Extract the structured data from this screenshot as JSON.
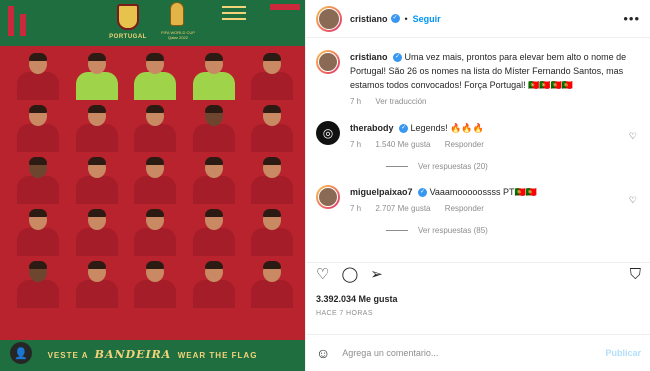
{
  "image": {
    "crest_label": "PORTUGAL",
    "wc_label": "FIFA WORLD CUP Qatar 2022",
    "footer": {
      "left": "VESTE A",
      "middle": "BANDEIRA",
      "right": "WEAR THE FLAG"
    },
    "colors": {
      "red": "#b8232e",
      "green": "#1f6e3f",
      "gold": "#f3d37a"
    }
  },
  "header": {
    "username": "cristiano",
    "verified": "✓",
    "separator": "•",
    "follow_label": "Seguir",
    "more_label": "•••"
  },
  "caption": {
    "username": "cristiano",
    "text": "Uma vez mais, prontos para elevar bem alto o nome de Portugal! São 26 os nomes na lista do Míster Fernando Santos, mas estamos todos convocados! Força Portugal! 🇵🇹🇵🇹🇵🇹🇵🇹",
    "time": "7 h",
    "translation": "Ver traducción"
  },
  "comments": [
    {
      "username": "therabody",
      "text": "Legends! 🔥🔥🔥",
      "time": "7 h",
      "likes": "1.540 Me gusta",
      "reply": "Responder",
      "replies": "Ver respuestas (20)"
    },
    {
      "username": "miguelpaixao7",
      "text": "Vaaamooooossss PT🇵🇹🇵🇹",
      "time": "7 h",
      "likes": "2.707 Me gusta",
      "reply": "Responder",
      "replies": "Ver respuestas (85)"
    }
  ],
  "likes_count": "3.392.034 Me gusta",
  "posted": "HACE 7 HORAS",
  "add_comment": {
    "placeholder": "Agrega un comentario...",
    "publish": "Publicar"
  }
}
